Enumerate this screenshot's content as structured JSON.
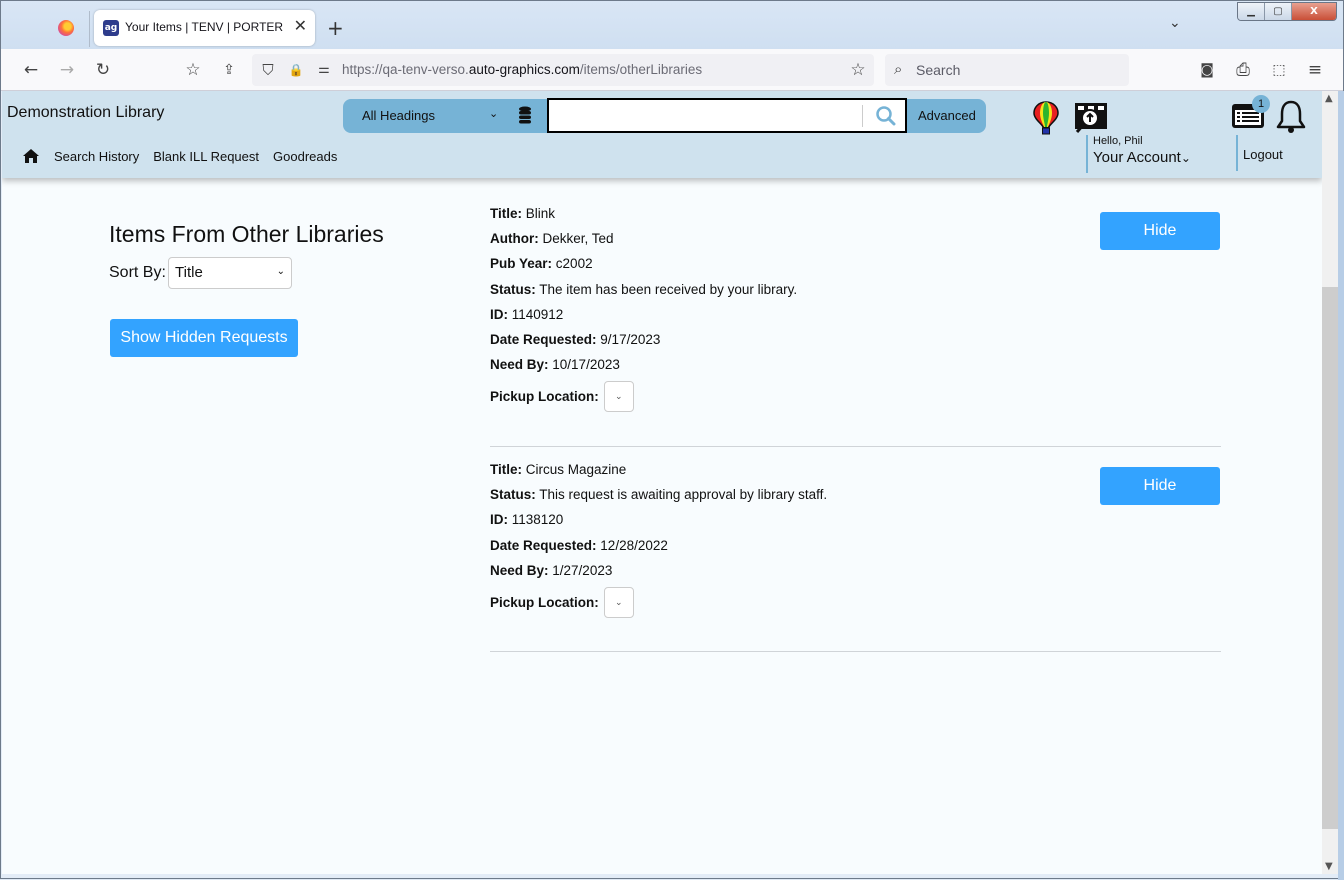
{
  "browser": {
    "tab_title": "Your Items | TENV | PORTER | Auto-Graphics",
    "favicon_text": "ag",
    "url_prefix": "https://qa-tenv-verso.",
    "url_domain": "auto-graphics.com",
    "url_path": "/items/otherLibraries",
    "search_placeholder": "Search",
    "icons": {
      "back": "←",
      "forward": "→",
      "reload": "↻",
      "bookmarks": "☆",
      "share": "⇪",
      "shield": "⛉",
      "lock": "🔒",
      "perm": "⚌",
      "star": "☆",
      "pocket": "◙",
      "print": "⎙",
      "extensions": "⬚",
      "menu": "≡",
      "close": "✕",
      "new_tab": "+",
      "tab_list": "⌄",
      "search": "⌕"
    },
    "window_buttons": {
      "minimize": "▁",
      "maximize": "▢",
      "close": "X"
    }
  },
  "header": {
    "library_name": "Demonstration Library",
    "search_scope": "All Headings",
    "search_value": "",
    "advanced_label": "Advanced",
    "nav_links": [
      "Search History",
      "Blank ILL Request",
      "Goodreads"
    ],
    "greeting": "Hello, Phil",
    "account_label": "Your Account",
    "list_badge_count": "1",
    "logout_label": "Logout",
    "chevron": "⌄"
  },
  "content": {
    "page_title": "Items From Other Libraries",
    "sort_label": "Sort By:",
    "sort_value": "Title",
    "show_hidden_label": "Show Hidden Requests",
    "hide_label": "Hide",
    "pickup_label": "Pickup Location:",
    "items": [
      {
        "fields": [
          {
            "k": "Title:",
            "v": "Blink"
          },
          {
            "k": "Author:",
            "v": "Dekker, Ted"
          },
          {
            "k": "Pub Year:",
            "v": "c2002"
          },
          {
            "k": "Status:",
            "v": "The item has been received by your library."
          },
          {
            "k": "ID:",
            "v": "1140912"
          },
          {
            "k": "Date Requested:",
            "v": "9/17/2023"
          },
          {
            "k": "Need By:",
            "v": "10/17/2023"
          }
        ],
        "pickup_value": ""
      },
      {
        "fields": [
          {
            "k": "Title:",
            "v": "Circus Magazine"
          },
          {
            "k": "Status:",
            "v": "This request is awaiting approval by library staff."
          },
          {
            "k": "ID:",
            "v": "1138120"
          },
          {
            "k": "Date Requested:",
            "v": "12/28/2022"
          },
          {
            "k": "Need By:",
            "v": "1/27/2023"
          }
        ],
        "pickup_value": ""
      }
    ]
  }
}
